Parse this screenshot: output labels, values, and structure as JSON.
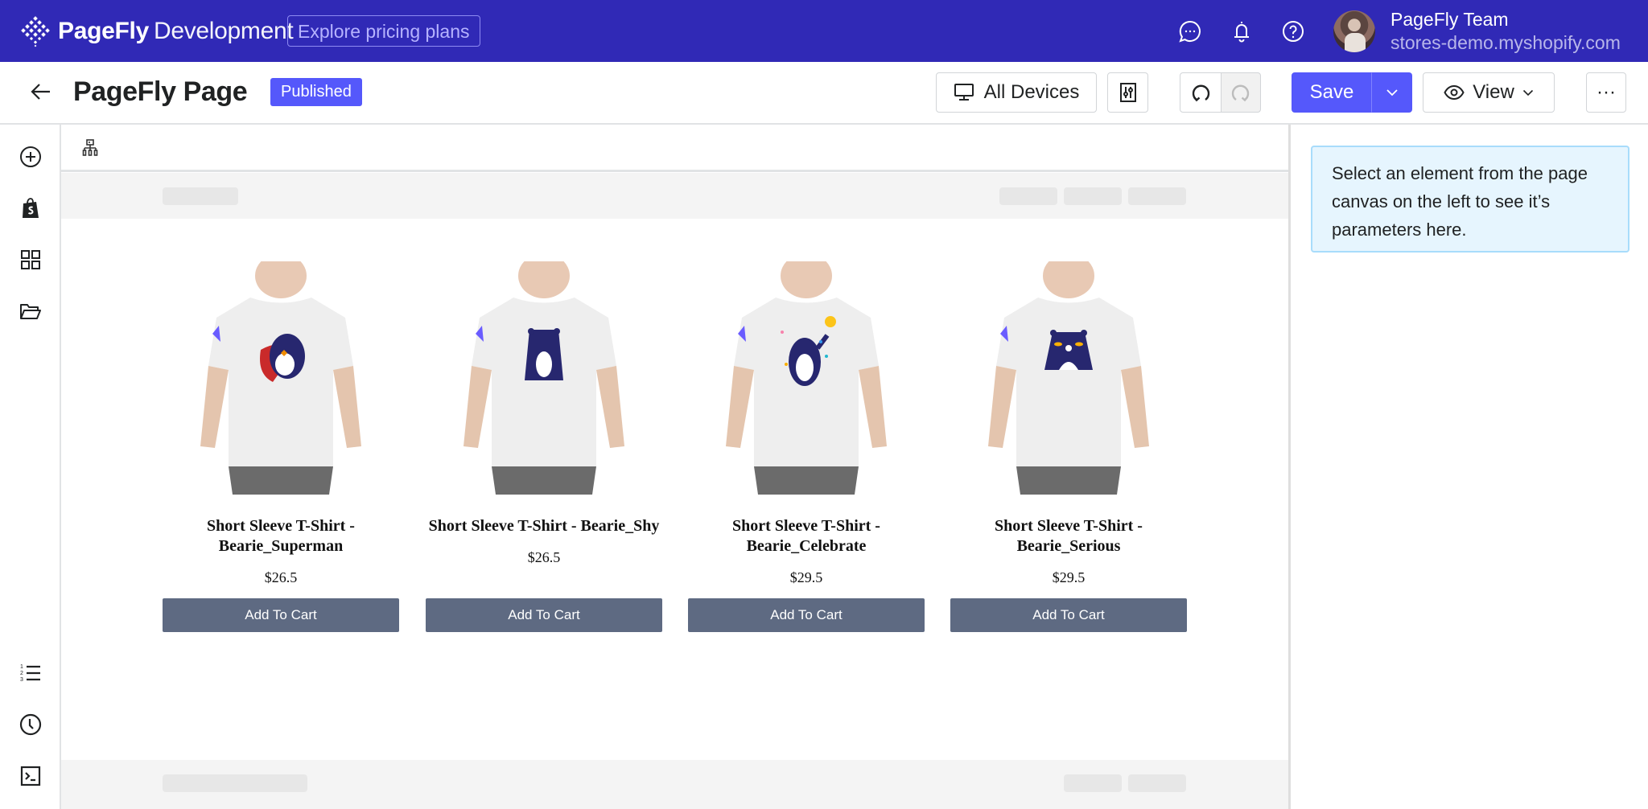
{
  "topbar": {
    "brand_name": "PageFly",
    "brand_suffix": "Development",
    "explore_label": "Explore pricing plans",
    "icons": [
      "chat-icon",
      "bell-icon",
      "help-icon"
    ],
    "user_name": "PageFly Team",
    "user_store": "stores-demo.myshopify.com"
  },
  "subheader": {
    "page_title": "PageFly Page",
    "status_badge": "Published",
    "devices_label": "All Devices",
    "save_label": "Save",
    "view_label": "View",
    "more_label": "···"
  },
  "colors": {
    "topbar_bg": "#3029b6",
    "accent": "#5558fb",
    "cart_button": "#5e6a82",
    "info_box_bg": "#e6f5fe",
    "info_box_border": "#a8dcfb"
  },
  "rail": {
    "top_items": [
      "add-element-icon",
      "shopify-icon",
      "sections-grid-icon",
      "folder-icon"
    ],
    "bottom_items": [
      "ordered-list-icon",
      "history-clock-icon",
      "terminal-icon"
    ]
  },
  "products": [
    {
      "title": "Short Sleeve T-Shirt - Bearie_Superman",
      "price": "$26.5",
      "button": "Add To Cart",
      "variant": "superman"
    },
    {
      "title": "Short Sleeve T-Shirt - Bearie_Shy",
      "price": "$26.5",
      "button": "Add To Cart",
      "variant": "shy"
    },
    {
      "title": "Short Sleeve T-Shirt - Bearie_Celebrate",
      "price": "$29.5",
      "button": "Add To Cart",
      "variant": "celebrate"
    },
    {
      "title": "Short Sleeve T-Shirt - Bearie_Serious",
      "price": "$29.5",
      "button": "Add To Cart",
      "variant": "serious"
    }
  ],
  "panel": {
    "info_text": "Select an element from the page canvas on the left to see it’s parameters here."
  }
}
